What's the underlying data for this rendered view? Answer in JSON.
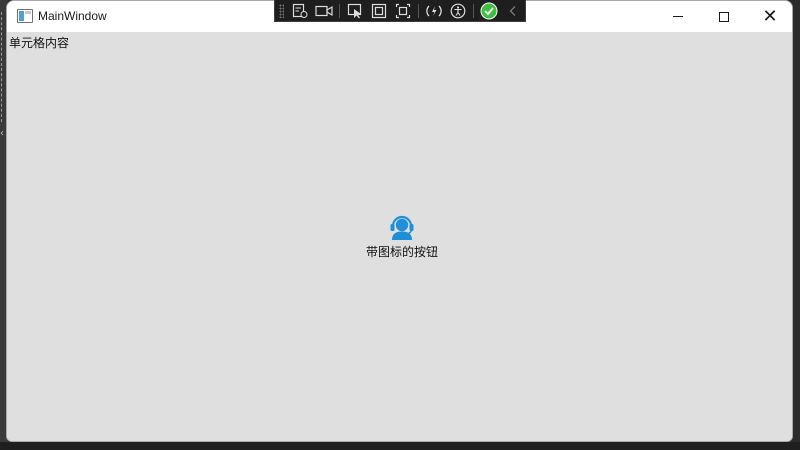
{
  "window": {
    "title": "MainWindow"
  },
  "debug_toolbar": {
    "items": [
      "live-visual-tree-icon",
      "record-icon",
      "select-element-icon",
      "display-layout-adorners-icon",
      "track-focus-icon",
      "hot-reload-icon",
      "accessibility-icon",
      "binding-status-icon",
      "collapse-icon"
    ]
  },
  "content": {
    "cell_text": "单元格内容",
    "icon_button": {
      "label": "带图标的按钮",
      "icon": "customer-service-headset-icon",
      "icon_color": "#1f8fd8"
    }
  },
  "colors": {
    "client_background": "#dfdfdf",
    "toolbar_background": "#1e1e1e",
    "status_ok": "#3fbf3f"
  }
}
